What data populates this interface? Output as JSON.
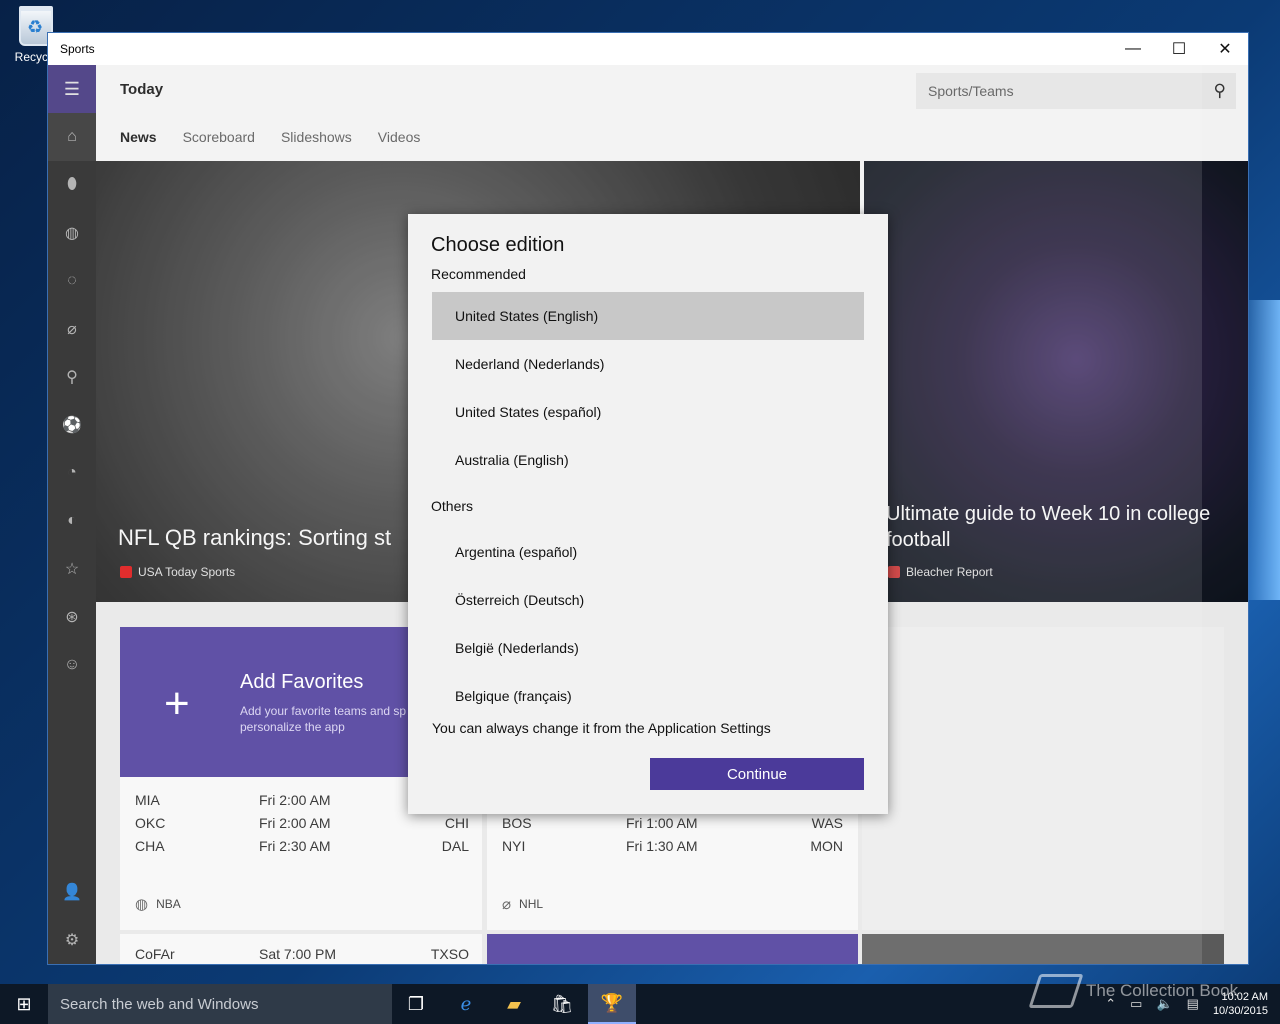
{
  "desktop": {
    "recycle_label": "Recycle"
  },
  "window": {
    "title": "Sports",
    "minimize": "—",
    "maximize": "☐",
    "close": "✕"
  },
  "header": {
    "page_title": "Today",
    "search_placeholder": "Sports/Teams"
  },
  "tabs": [
    {
      "label": "News",
      "active": true
    },
    {
      "label": "Scoreboard",
      "active": false
    },
    {
      "label": "Slideshows",
      "active": false
    },
    {
      "label": "Videos",
      "active": false
    }
  ],
  "hero": {
    "left_headline": "NFL QB rankings: Sorting st",
    "left_source": "USA Today Sports",
    "right_headline": "Ultimate guide to Week 10 in college football",
    "right_source": "Bleacher Report"
  },
  "favorites": {
    "title": "Add Favorites",
    "description": "Add your favorite teams and sp personalize the app"
  },
  "nba_card": {
    "rows": [
      {
        "team1": "MIA",
        "time": "Fri 2:00 AM",
        "team2": ""
      },
      {
        "team1": "OKC",
        "time": "Fri 2:00 AM",
        "team2": "CHI"
      },
      {
        "team1": "CHA",
        "time": "Fri 2:30 AM",
        "team2": "DAL"
      }
    ],
    "league": "NBA"
  },
  "nhl_card": {
    "rows": [
      {
        "team1": "BOS",
        "time": "Fri 1:00 AM",
        "team2": "WAS"
      },
      {
        "team1": "NYI",
        "time": "Fri 1:30 AM",
        "team2": "MON"
      }
    ],
    "league": "NHL"
  },
  "next_card": {
    "team1": "CoFAr",
    "time": "Sat 7:00 PM",
    "team2": "TXSO"
  },
  "dialog": {
    "title": "Choose edition",
    "recommended_label": "Recommended",
    "recommended": [
      {
        "label": "United States (English)",
        "selected": true
      },
      {
        "label": "Nederland (Nederlands)",
        "selected": false
      },
      {
        "label": "United States (español)",
        "selected": false
      },
      {
        "label": "Australia (English)",
        "selected": false
      }
    ],
    "others_label": "Others",
    "others": [
      {
        "label": "Argentina (español)"
      },
      {
        "label": "Österreich (Deutsch)"
      },
      {
        "label": "België (Nederlands)"
      },
      {
        "label": "Belgique (français)"
      }
    ],
    "note": "You can always change it from the Application Settings",
    "continue_label": "Continue"
  },
  "taskbar": {
    "search_placeholder": "Search the web and Windows",
    "time": "10:02 AM",
    "date": "10/30/2015"
  },
  "watermark": {
    "text": "The Collection Book"
  },
  "colors": {
    "accent": "#4b3a9a",
    "selected_edition": "#c8c8c8",
    "sidebar": "#1f1f1f"
  }
}
